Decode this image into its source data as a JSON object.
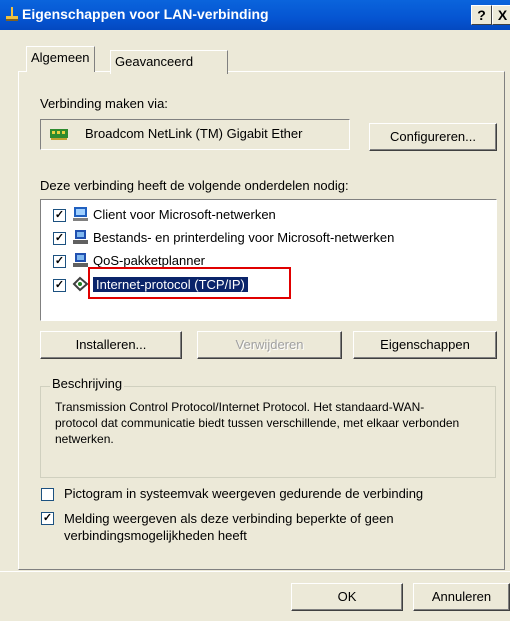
{
  "window": {
    "title": "Eigenschappen voor LAN-verbinding",
    "help_button": "?",
    "close_button": "X"
  },
  "tabs": [
    {
      "label": "Algemeen",
      "active": true
    },
    {
      "label": "Geavanceerd",
      "active": false
    }
  ],
  "connect_via": {
    "label": "Verbinding maken via:",
    "adapter": "Broadcom NetLink (TM) Gigabit Ether",
    "configure_button": "Configureren..."
  },
  "components": {
    "label": "Deze verbinding heeft de volgende onderdelen nodig:",
    "items": [
      {
        "label": "Client voor Microsoft-netwerken",
        "checked": true,
        "icon": "network-client-icon"
      },
      {
        "label": "Bestands- en printerdeling voor Microsoft-netwerken",
        "checked": true,
        "icon": "file-printer-sharing-icon"
      },
      {
        "label": "QoS-pakketplanner",
        "checked": true,
        "icon": "qos-scheduler-icon"
      },
      {
        "label": "Internet-protocol (TCP/IP)",
        "checked": true,
        "icon": "protocol-icon",
        "selected": true
      }
    ],
    "buttons": {
      "install": "Installeren...",
      "remove": "Verwijderen",
      "properties": "Eigenschappen"
    }
  },
  "description": {
    "legend": "Beschrijving",
    "text": "Transmission Control Protocol/Internet Protocol. Het standaard-WAN-protocol dat communicatie biedt tussen verschillende, met elkaar verbonden netwerken."
  },
  "options": [
    {
      "label": "Pictogram in systeemvak weergeven gedurende de verbinding",
      "checked": false
    },
    {
      "label": "Melding weergeven als deze verbinding beperkte of geen verbindingsmogelijkheden heeft",
      "checked": true
    }
  ],
  "footer": {
    "ok": "OK",
    "cancel": "Annuleren"
  },
  "colors": {
    "titlebar": "#0555d2",
    "dialog_bg": "#ece9d8",
    "selection": "#0a246a",
    "highlight_box": "#e00000"
  }
}
